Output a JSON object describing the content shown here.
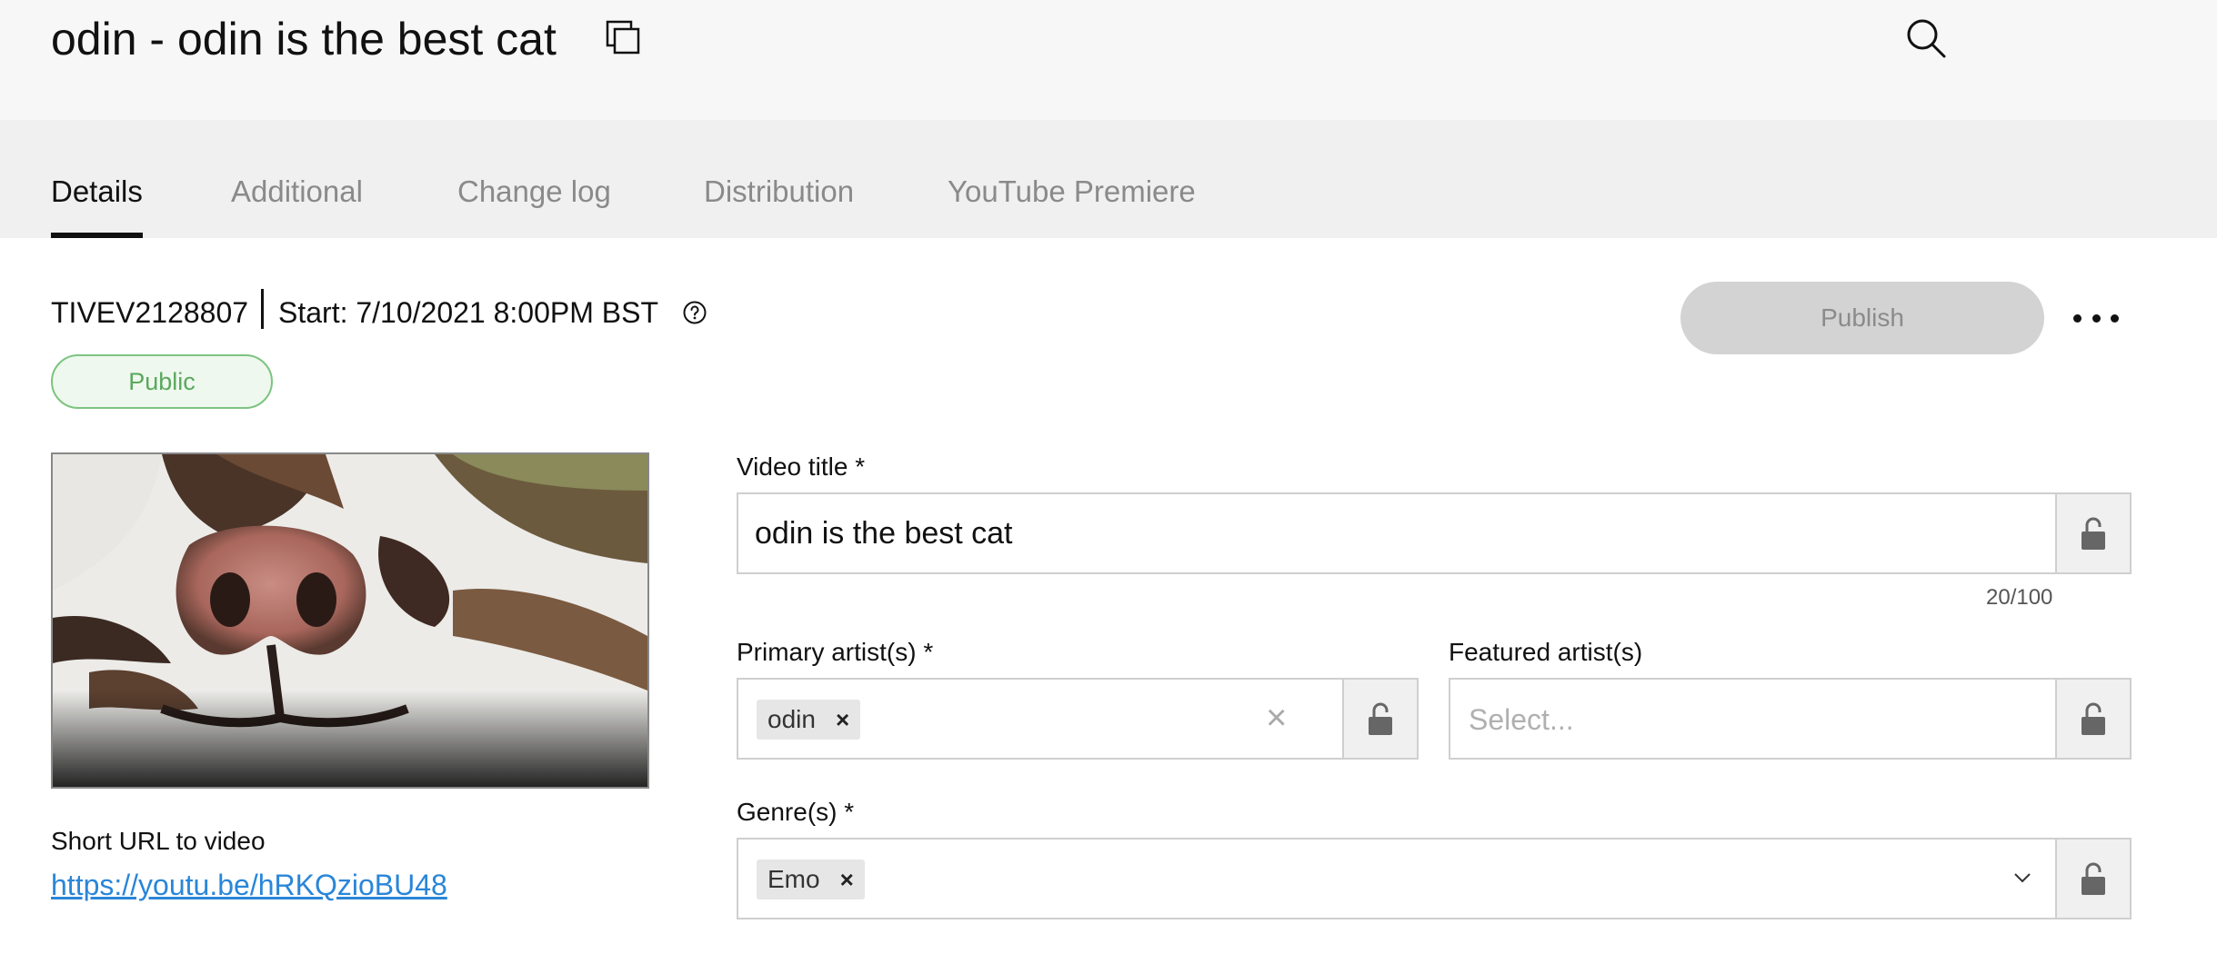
{
  "header": {
    "title": "odin - odin is the best cat"
  },
  "tabs": [
    {
      "label": "Details",
      "active": true
    },
    {
      "label": "Additional",
      "active": false
    },
    {
      "label": "Change log",
      "active": false
    },
    {
      "label": "Distribution",
      "active": false
    },
    {
      "label": "YouTube Premiere",
      "active": false
    }
  ],
  "meta": {
    "event_id": "TIVEV2128807",
    "start": "Start: 7/10/2021 8:00PM BST",
    "status": "Public"
  },
  "actions": {
    "publish_label": "Publish"
  },
  "short_url": {
    "label": "Short URL to video",
    "url": "https://youtu.be/hRKQzioBU48"
  },
  "form": {
    "video_title": {
      "label": "Video title *",
      "value": "odin is the best cat",
      "counter": "20/100"
    },
    "primary_artists": {
      "label": "Primary artist(s) *",
      "chips": [
        "odin"
      ]
    },
    "featured_artists": {
      "label": "Featured artist(s)",
      "placeholder": "Select..."
    },
    "genres": {
      "label": "Genre(s) *",
      "chips": [
        "Emo"
      ]
    }
  },
  "icons": {
    "copy": "copy-icon",
    "search": "search-icon",
    "help": "help-icon",
    "lock": "lock-open-icon",
    "more": "more-horizontal-icon",
    "chevron": "chevron-down-icon",
    "remove": "×"
  },
  "colors": {
    "status_green": "#5aa85e",
    "link_blue": "#2a86d8",
    "publish_disabled": "#d3d3d3"
  }
}
